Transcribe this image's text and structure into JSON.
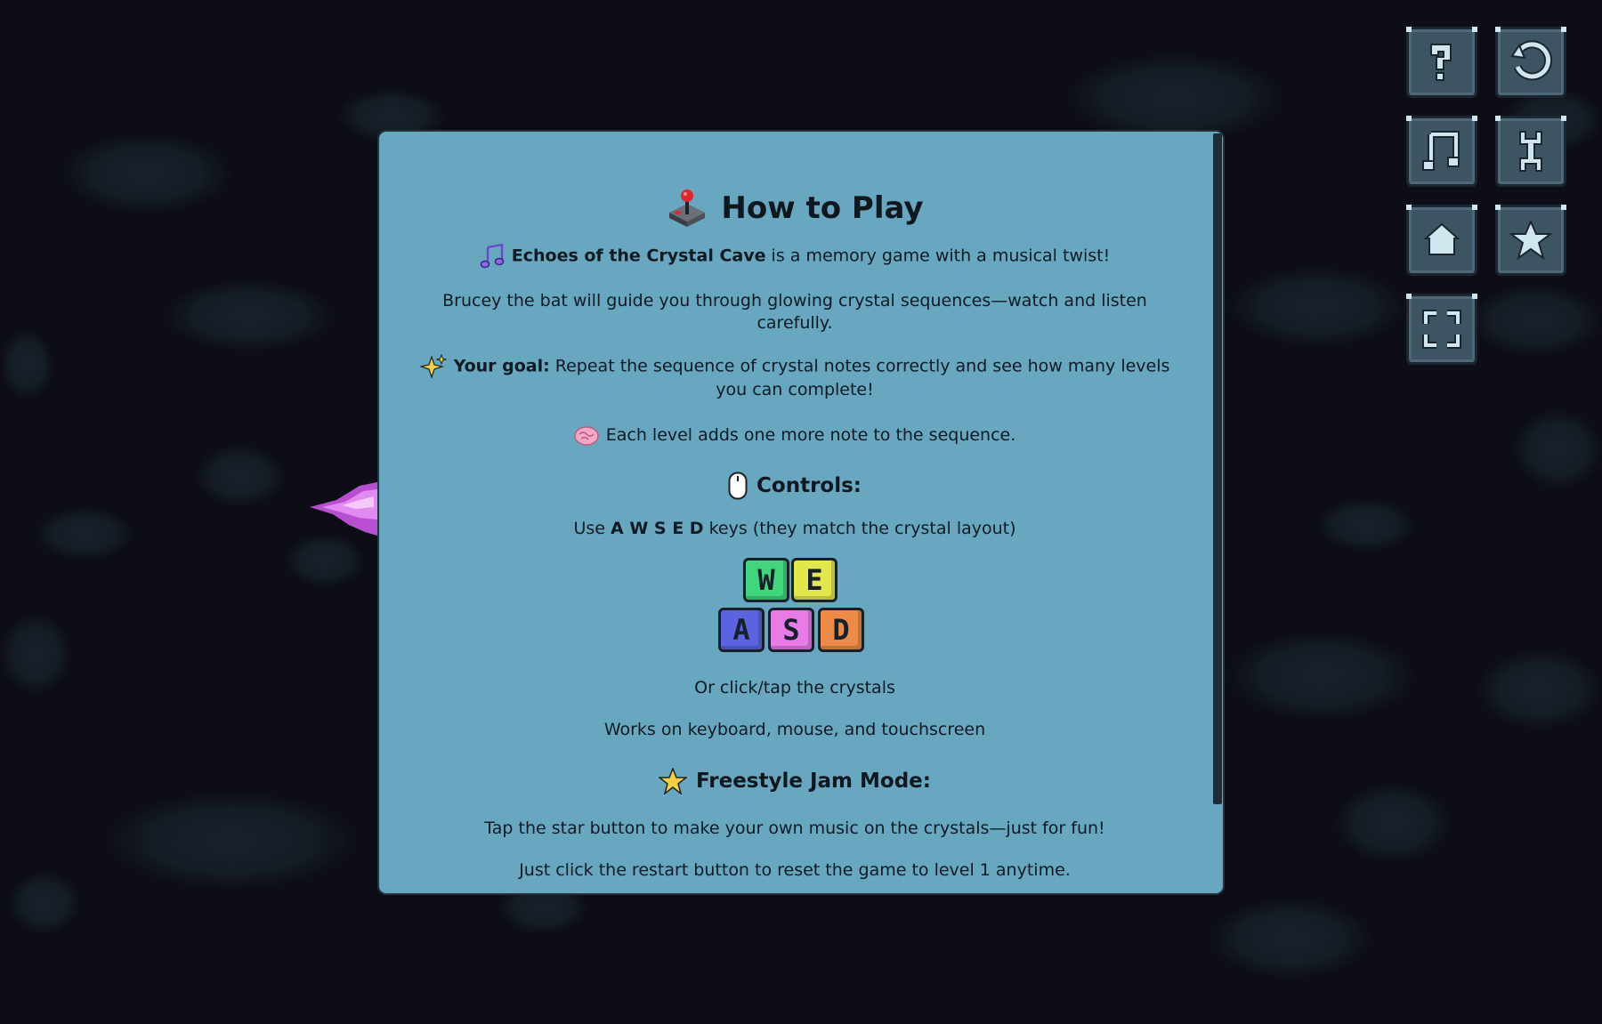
{
  "modal": {
    "title": "How to Play",
    "intro_game_name": "Echoes of the Crystal Cave",
    "intro_rest": " is a memory game with a musical twist!",
    "guide_text": "Brucey the bat will guide you through glowing crystal sequences—watch and listen carefully.",
    "goal_label": "Your goal:",
    "goal_text": " Repeat the sequence of crystal notes correctly and see how many levels you can complete!",
    "level_text": "Each level adds one more note to the sequence.",
    "controls_title": "Controls:",
    "controls_use": "Use ",
    "controls_keys": "A W S E D",
    "controls_rest": " keys (they match the crystal layout)",
    "keys": {
      "w": "W",
      "e": "E",
      "a": "A",
      "s": "S",
      "d": "D",
      "colors": {
        "w": "#3fd67c",
        "e": "#e2e84a",
        "a": "#5b63e0",
        "s": "#e97ae6",
        "d": "#ec8a46"
      }
    },
    "click_text": "Or click/tap the crystals",
    "works_text": "Works on keyboard, mouse, and touchscreen",
    "freestyle_title": "Freestyle Jam Mode:",
    "freestyle_text": "Tap the star button to make your own music on the crystals—just for fun!",
    "restart_text": "Just click the restart button to reset the game to level 1 anytime."
  },
  "toolbar": {
    "buttons": [
      {
        "name": "help",
        "icon": "question-mark-icon"
      },
      {
        "name": "restart",
        "icon": "restart-icon"
      },
      {
        "name": "music",
        "icon": "music-note-icon"
      },
      {
        "name": "settings",
        "icon": "wrench-icon"
      },
      {
        "name": "home",
        "icon": "home-icon"
      },
      {
        "name": "freestyle",
        "icon": "star-icon"
      },
      {
        "name": "fullscreen",
        "icon": "fullscreen-icon"
      }
    ]
  },
  "colors": {
    "background": "#0d0d15",
    "modal": "#67a7c0",
    "button": "#3d5462",
    "icon": "#cfe6ee"
  }
}
